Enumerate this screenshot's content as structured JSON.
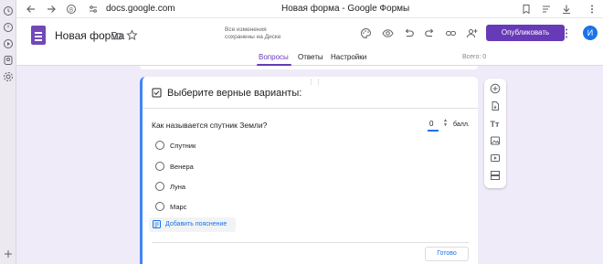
{
  "browser": {
    "url": "docs.google.com",
    "tab_title": "Новая форма - Google Формы"
  },
  "header": {
    "doc_title": "Новая форма",
    "saved_status": "Все изменения сохранены на Диске",
    "publish_label": "Опубликовать",
    "avatar_letter": "И",
    "tabs": [
      {
        "label": "Вопросы",
        "active": true
      },
      {
        "label": "Ответы",
        "active": false
      },
      {
        "label": "Настройки",
        "active": false
      }
    ],
    "total_label": "Всего: 0"
  },
  "question": {
    "header_text": "Выберите верные варианты:",
    "text": "Как называется спутник Земли?",
    "points_value": "0",
    "points_label": "балл.",
    "options": [
      "Спутник",
      "Венера",
      "Луна",
      "Марс"
    ],
    "feedback_label": "Добавить пояснение",
    "done_label": "Готово"
  },
  "colors": {
    "accent": "#673ab7",
    "link_blue": "#1a73e8",
    "page_bg": "#f0ebf8"
  },
  "icons": {
    "sidebar": [
      "clock-icon",
      "history-icon",
      "play-icon",
      "nine-icon",
      "gear-icon",
      "add-icon"
    ],
    "toolbar": [
      "add-question-icon",
      "import-icon",
      "title-icon",
      "image-icon",
      "video-icon",
      "section-icon"
    ]
  }
}
